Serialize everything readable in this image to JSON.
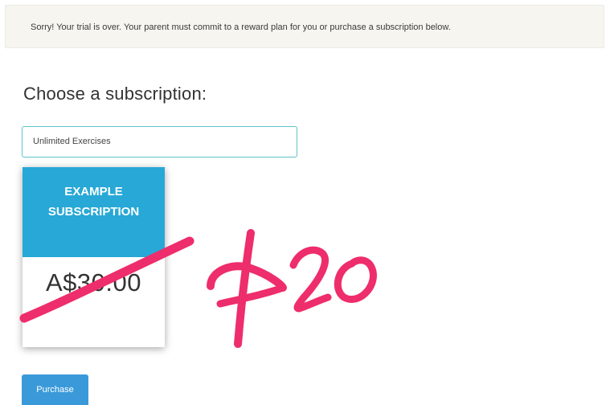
{
  "alert": {
    "message": "Sorry! Your trial is over. Your parent must commit to a reward plan for you or purchase a subscription below."
  },
  "subscription": {
    "heading": "Choose a subscription:",
    "select_value": "Unlimited Exercises",
    "card": {
      "title_line1": "EXAMPLE",
      "title_line2": "SUBSCRIPTION",
      "price": "A$30.00"
    },
    "purchase_label": "Purchase"
  },
  "annotation": {
    "handwritten_text": "$20",
    "ink_color": "#ee2d6c"
  },
  "colors": {
    "card_header": "#27a8d6",
    "select_border": "#5fc3c9",
    "purchase_button": "#3a9ad9",
    "alert_background": "#f6f5f0"
  }
}
